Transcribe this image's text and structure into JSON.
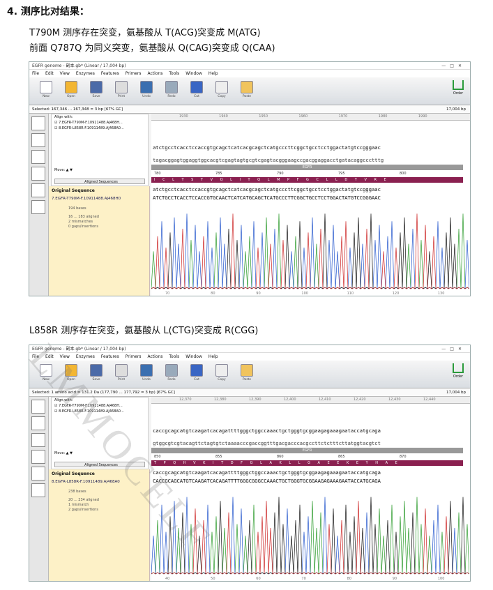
{
  "heading": "4.  测序比对结果：",
  "lines": [
    "T790M 测序存在突变，氨基酸从 T(ACG)突变成 M(ATG)",
    "前面 Q787Q 为同义突变，氨基酸从 Q(CAG)突变成 Q(CAA)",
    "L858R 测序存在突变，氨基酸从 L(CTG)突变成 R(CGG)"
  ],
  "watermark": "LMMOCELF",
  "app": {
    "title": "EGFR genome - 副本.gb* (Linear / 17,004 bp)",
    "menu": [
      "File",
      "Edit",
      "View",
      "Enzymes",
      "Features",
      "Primers",
      "Actions",
      "Tools",
      "Window",
      "Help"
    ],
    "tools": [
      "New",
      "Open",
      "Save",
      "Print",
      "Undo",
      "Redo",
      "Cut",
      "Copy",
      "Paste"
    ],
    "order": "Order",
    "total_bp": "17,004 bp",
    "align_with": "Align with:",
    "reads": [
      "7.EGFR-T790M-F.10911488.AJ468H...",
      "8.EGFR-L858R-F.10911489.AJ468A0..."
    ],
    "move": "Move:",
    "aligned_sequences": "Aligned Sequences",
    "original_sequence": "Original Sequence",
    "feature": "EGFR"
  },
  "shots": [
    {
      "selected": "Selected: 167,346 ... 167,348 = 3 bp   [67% GC]",
      "ruler": [
        "1930",
        "1940",
        "1950",
        "1960",
        "1970",
        "1980",
        "1990"
      ],
      "top": "atctgcctcacctccaccgtgcagctcatcacgcagctcatgcccttcggctgcctcctggactatgtccgggaac",
      "comp": "tagacggagtggaggtggcacgtcgagtagtgcgtcgagtacgggaagccgacggaggacctgatacaggccctttg",
      "aanums": [
        "780",
        "785",
        "790",
        "795",
        "800"
      ],
      "aas": "I C L T S T V Q L I T Q L M P F G C L L D Y V R E",
      "read_top": "atctgcctcacctccaccgtgcagctcatcacgcagctcatgcccttcggctgcctcctggactatgtccgggaac",
      "read": "ATCTGCCTCACCTCCACCGTGCAACTCATCATGCAGCTCATGCCCTTCGGCTGCCTCCTGGACTATGTCCGGGAAC",
      "read_name": "7.EGFR-T790M-F.10911488.AJ468H0",
      "info": [
        "194 bases",
        "16 ... 183 aligned",
        "2 mismatches",
        "0 gaps/insertions"
      ],
      "tick": [
        "70",
        "80",
        "90",
        "100",
        "110",
        "120",
        "130"
      ]
    },
    {
      "selected": "Selected: 1 amino acid = 131.2 Da (177,790 ... 177,792 = 3 bp)   [67% GC]",
      "ruler": [
        "12,370",
        "12,380",
        "12,390",
        "12,400",
        "12,410",
        "12,420",
        "12,430",
        "12,440"
      ],
      "top": "caccgcagcatgtcaagatcacagattttgggctggccaaactgctgggtgcggaagagaaagaataccatgcaga",
      "comp": "gtggcgtcgtacagttctagtgtctaaaacccgaccggtttgacgacccacgccttctctttcttatggtacgtct",
      "aanums": [
        "850",
        "855",
        "860",
        "865",
        "870"
      ],
      "aas": "T P Q H V K I T D F G L A K L L G A E E K E Y H A E",
      "read_top": "caccgcagcatgtcaagatcacagattttgggctggccaaactgctgggtgcggaagagaaagaataccatgcaga",
      "read": "CACCGCAGCATGTCAAGATCACAGATTTTGGGCGGGCCAAACTGCTGGGTGCGGAAGAGAAAGAATACCATGCAGA",
      "read_name": "8.EGFR-L858R-F.10911489.AJ468A0",
      "info": [
        "238 bases",
        "20 ... 234 aligned",
        "1 mismatch",
        "2 gaps/insertions"
      ],
      "tick": [
        "40",
        "50",
        "60",
        "70",
        "80",
        "90",
        "100"
      ]
    }
  ]
}
